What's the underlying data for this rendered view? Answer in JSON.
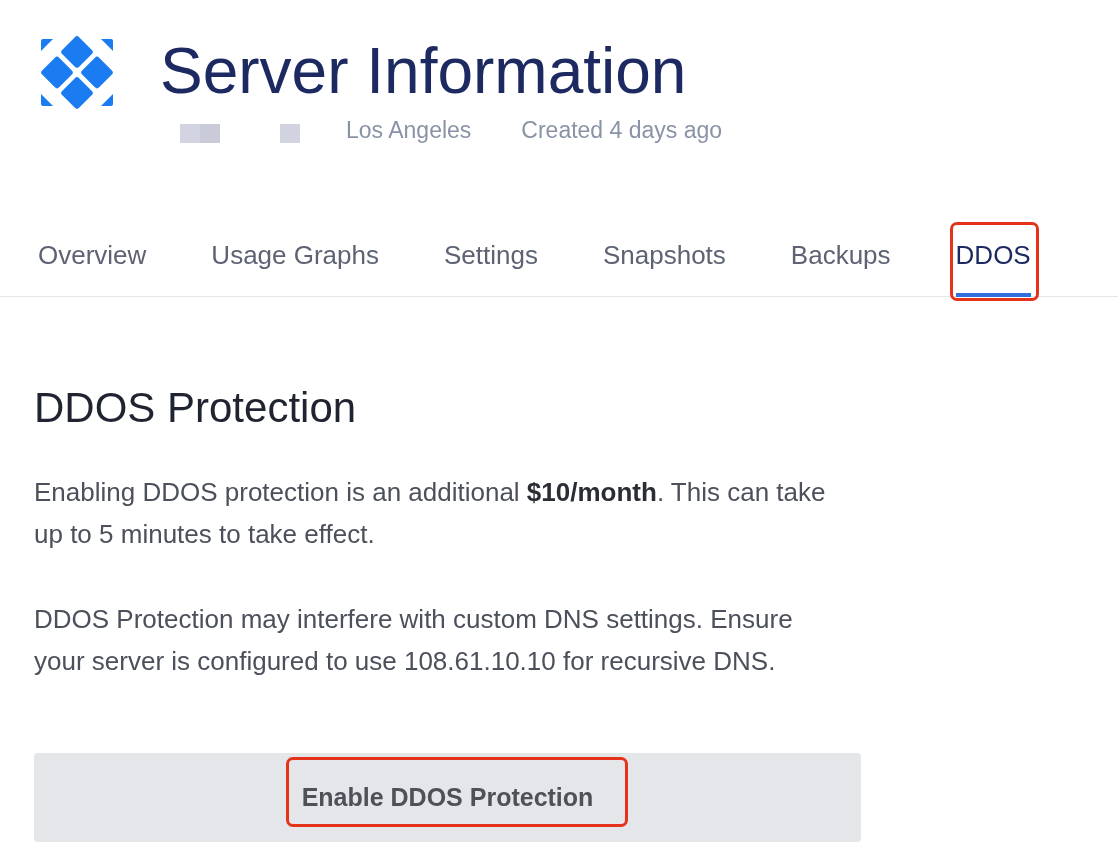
{
  "header": {
    "title": "Server Information",
    "address": {
      "redacted": true
    },
    "location": "Los Angeles",
    "created": "Created 4 days ago"
  },
  "tabs": [
    {
      "label": "Overview",
      "selected": false,
      "highlighted": false
    },
    {
      "label": "Usage Graphs",
      "selected": false,
      "highlighted": false
    },
    {
      "label": "Settings",
      "selected": false,
      "highlighted": false
    },
    {
      "label": "Snapshots",
      "selected": false,
      "highlighted": false
    },
    {
      "label": "Backups",
      "selected": false,
      "highlighted": false
    },
    {
      "label": "DDOS",
      "selected": true,
      "highlighted": true
    }
  ],
  "section": {
    "heading": "DDOS Protection",
    "paragraphs": [
      "Enabling DDOS protection is an additional **$10/month**. This can take up to 5 minutes to take effect.",
      "DDOS Protection may interfere with custom DNS settings. Ensure your server is configured to use 108.61.10.10 for recursive DNS."
    ],
    "button": {
      "label": "Enable DDOS Protection",
      "highlighted": true
    }
  }
}
